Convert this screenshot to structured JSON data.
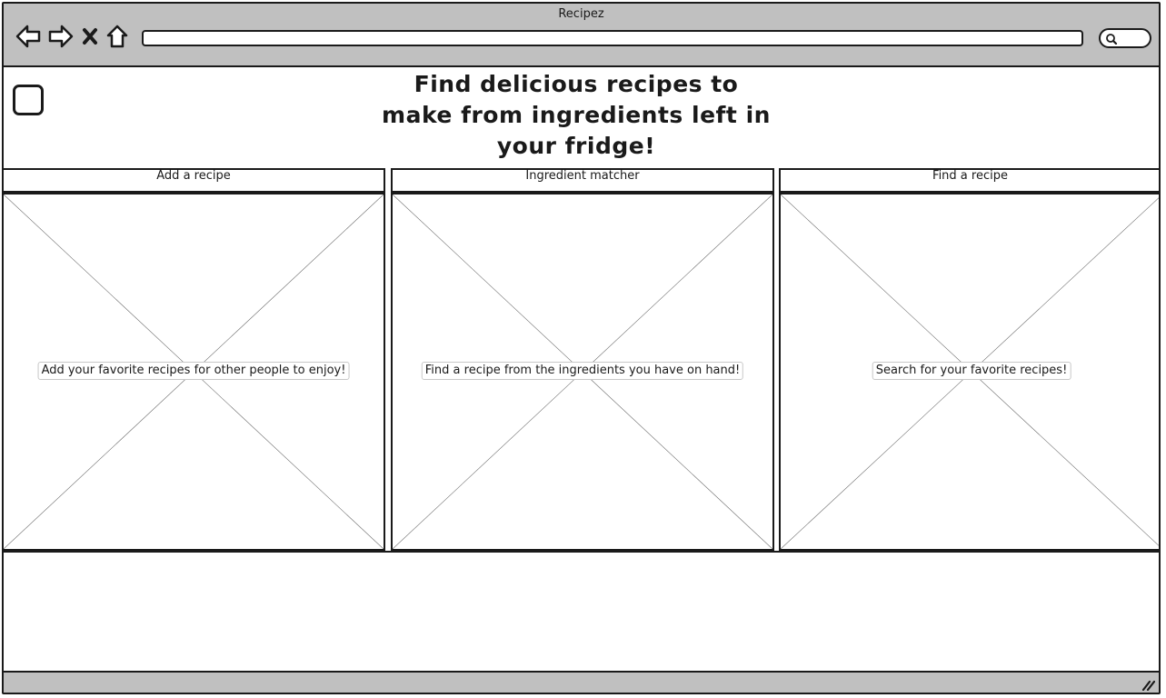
{
  "window": {
    "title": "Recipez",
    "address_value": "",
    "search_value": ""
  },
  "toolbar": {
    "back_icon": "back-arrow-icon",
    "forward_icon": "forward-arrow-icon",
    "stop_icon": "close-icon",
    "home_icon": "home-icon",
    "search_icon": "search-icon"
  },
  "page": {
    "headline": "Find delicious recipes to make from ingredients left in your fridge!"
  },
  "sections": [
    {
      "header": "Add a recipe",
      "caption": "Add your favorite recipes for other people to enjoy!"
    },
    {
      "header": "Ingredient matcher",
      "caption": "Find a recipe from the ingredients you have on hand!"
    },
    {
      "header": "Find a recipe",
      "caption": "Search for your favorite recipes!"
    }
  ],
  "colors": {
    "chrome": "#c0c0c0",
    "stroke": "#1a1a1a",
    "placeholder_cross": "#555555"
  }
}
